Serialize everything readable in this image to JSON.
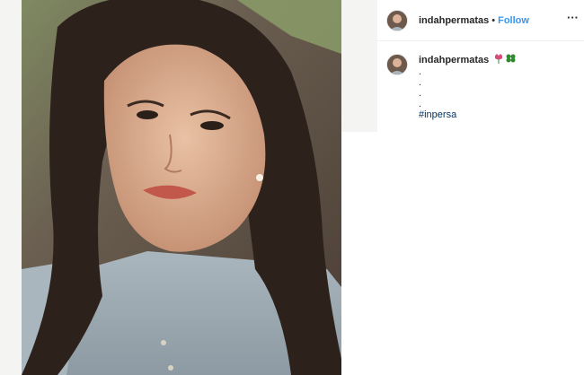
{
  "post": {
    "photo_icon": "selfie-photo",
    "username": "indahpermatas",
    "separator": "•",
    "follow_label": "Follow",
    "more_icon": "more-options-icon",
    "more_glyph": "···"
  },
  "caption": {
    "username": "indahpermatas",
    "emojis": [
      "tulip-emoji",
      "four-leaf-clover-emoji"
    ],
    "lines": [
      ".",
      ".",
      ".",
      "."
    ],
    "hashtag": "#inpersa"
  },
  "colors": {
    "follow_blue": "#3897f0",
    "hashtag_blue": "#003569"
  }
}
